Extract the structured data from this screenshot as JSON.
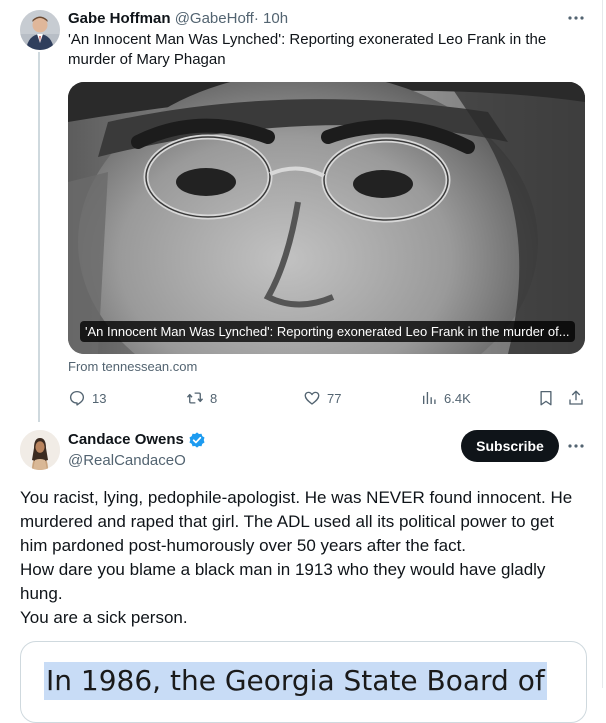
{
  "tweet1": {
    "author_name": "Gabe Hoffman",
    "author_handle": "@GabeHoff",
    "separator": "·",
    "time": "10h",
    "text": "'An Innocent Man Was Lynched': Reporting exonerated Leo Frank in the murder of Mary Phagan",
    "media_caption": "'An Innocent Man Was Lynched': Reporting exonerated Leo Frank in the murder of...",
    "source": "From tennessean.com",
    "actions": {
      "replies": "13",
      "reposts": "8",
      "likes": "77",
      "views": "6.4K"
    }
  },
  "tweet2": {
    "author_name": "Candace Owens",
    "author_handle": "@RealCandaceO",
    "subscribe_label": "Subscribe",
    "paragraphs": [
      "You racist, lying, pedophile-apologist. He was NEVER found innocent. He murdered and raped that girl. The ADL used all its political power to get him pardoned post-humorously over 50 years after the fact.",
      "How dare you blame a black man in 1913 who they would have gladly hung.",
      "You are a sick person."
    ],
    "quoted_image_text": "In 1986, the Georgia State Board of"
  },
  "icons": {
    "more": "more-horizontal-icon",
    "reply": "reply-icon",
    "repost": "repost-icon",
    "like": "heart-icon",
    "views": "views-icon",
    "bookmark": "bookmark-icon",
    "share": "share-icon",
    "verified": "verified-badge-icon"
  },
  "colors": {
    "text_primary": "#0f1419",
    "text_secondary": "#536471",
    "verified_blue": "#1d9bf0",
    "subscribe_bg": "#0f1419",
    "highlight": "#c8dcf6"
  }
}
